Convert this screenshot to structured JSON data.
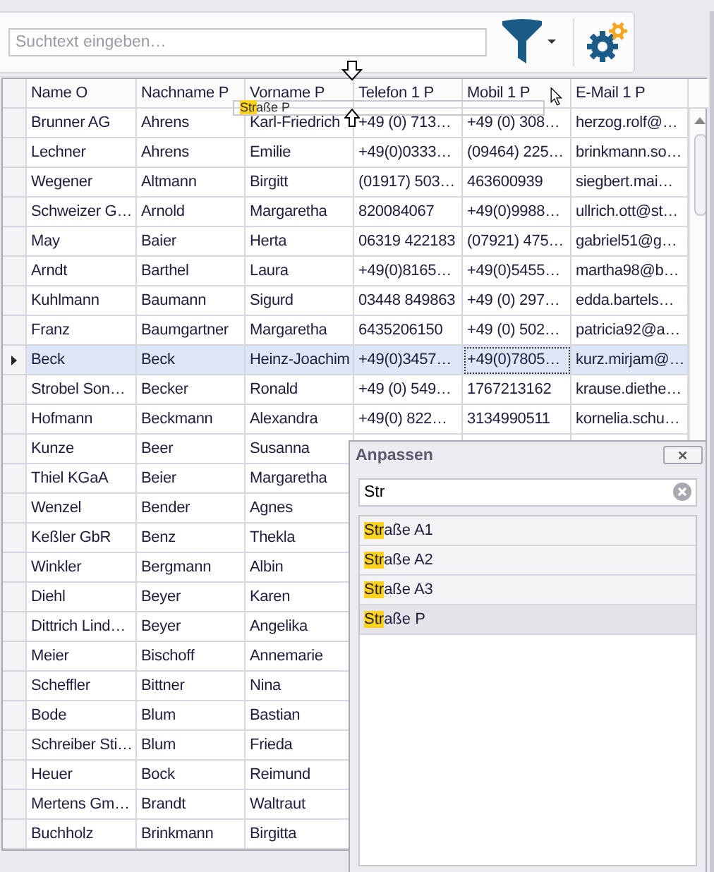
{
  "search": {
    "placeholder": "Suchtext eingeben…"
  },
  "columns": [
    {
      "label": "Name O"
    },
    {
      "label": "Nachname P"
    },
    {
      "label": "Vorname P"
    },
    {
      "label": "Telefon 1 P"
    },
    {
      "label": "Mobil 1 P"
    },
    {
      "label": "E-Mail 1 P"
    }
  ],
  "drag_ghost": {
    "match": "Str",
    "rest": "aße P"
  },
  "rows": [
    {
      "selected": false,
      "cells": [
        "Brunner AG",
        "Ahrens",
        "Karl-Friedrich",
        "+49 (0) 713…",
        "+49 (0) 308…",
        "herzog.rolf@…"
      ]
    },
    {
      "selected": false,
      "cells": [
        "Lechner",
        "Ahrens",
        "Emilie",
        "+49(0)0333…",
        "(09464) 225…",
        "brinkmann.so…"
      ]
    },
    {
      "selected": false,
      "cells": [
        "Wegener",
        "Altmann",
        "Birgitt",
        "(01917) 503…",
        "463600939",
        "siegbert.mai…"
      ]
    },
    {
      "selected": false,
      "cells": [
        "Schweizer G…",
        "Arnold",
        "Margaretha",
        "820084067",
        "+49(0)9988…",
        "ullrich.ott@st…"
      ]
    },
    {
      "selected": false,
      "cells": [
        "May",
        "Baier",
        "Herta",
        "06319 422183",
        "(07921) 475…",
        "gabriel51@g…"
      ]
    },
    {
      "selected": false,
      "cells": [
        "Arndt",
        "Barthel",
        "Laura",
        "+49(0)8165…",
        "+49(0)5455…",
        "martha98@b…"
      ]
    },
    {
      "selected": false,
      "cells": [
        "Kuhlmann",
        "Baumann",
        "Sigurd",
        "03448 849863",
        "+49 (0) 297…",
        "edda.bartels…"
      ]
    },
    {
      "selected": false,
      "cells": [
        "Franz",
        "Baumgartner",
        "Margaretha",
        "6435206150",
        "+49 (0) 502…",
        "patricia92@a…"
      ]
    },
    {
      "selected": true,
      "cells": [
        "Beck",
        "Beck",
        "Heinz-Joachim",
        "+49(0)3457…",
        "+49(0)7805…",
        "kurz.mirjam@…"
      ]
    },
    {
      "selected": false,
      "cells": [
        "Strobel Son…",
        "Becker",
        "Ronald",
        "+49 (0) 549…",
        "1767213162",
        "krause.diethe…"
      ]
    },
    {
      "selected": false,
      "cells": [
        "Hofmann",
        "Beckmann",
        "Alexandra",
        "+49(0) 822…",
        "3134990511",
        "kornelia.schu…"
      ]
    },
    {
      "selected": false,
      "cells": [
        "Kunze",
        "Beer",
        "Susanna"
      ]
    },
    {
      "selected": false,
      "cells": [
        "Thiel KGaA",
        "Beier",
        "Margaretha"
      ]
    },
    {
      "selected": false,
      "cells": [
        "Wenzel",
        "Bender",
        "Agnes"
      ]
    },
    {
      "selected": false,
      "cells": [
        "Keßler GbR",
        "Benz",
        "Thekla"
      ]
    },
    {
      "selected": false,
      "cells": [
        "Winkler",
        "Bergmann",
        "Albin"
      ]
    },
    {
      "selected": false,
      "cells": [
        "Diehl",
        "Beyer",
        "Karen"
      ]
    },
    {
      "selected": false,
      "cells": [
        "Dittrich Lind…",
        "Beyer",
        "Angelika"
      ]
    },
    {
      "selected": false,
      "cells": [
        "Meier",
        "Bischoff",
        "Annemarie"
      ]
    },
    {
      "selected": false,
      "cells": [
        "Scheffler",
        "Bittner",
        "Nina"
      ]
    },
    {
      "selected": false,
      "cells": [
        "Bode",
        "Blum",
        "Bastian"
      ]
    },
    {
      "selected": false,
      "cells": [
        "Schreiber Sti…",
        "Blum",
        "Frieda"
      ]
    },
    {
      "selected": false,
      "cells": [
        "Heuer",
        "Bock",
        "Reimund"
      ]
    },
    {
      "selected": false,
      "cells": [
        "Mertens Gm…",
        "Brandt",
        "Waltraut"
      ]
    },
    {
      "selected": false,
      "cells": [
        "Buchholz",
        "Brinkmann",
        "Birgitta"
      ]
    }
  ],
  "popup": {
    "title": "Anpassen",
    "close": "✕",
    "search_value": "Str",
    "items": [
      {
        "match": "Str",
        "rest": "aße A1",
        "selected": false
      },
      {
        "match": "Str",
        "rest": "aße A2",
        "selected": false
      },
      {
        "match": "Str",
        "rest": "aße A3",
        "selected": false
      },
      {
        "match": "Str",
        "rest": "aße P",
        "selected": true
      }
    ]
  }
}
